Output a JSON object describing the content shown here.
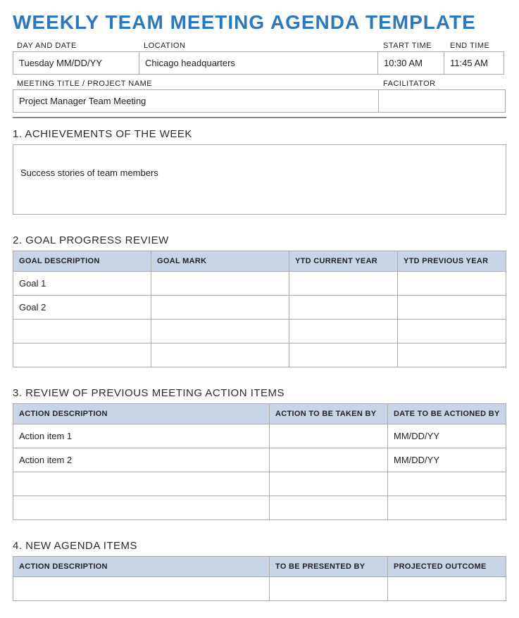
{
  "title": "WEEKLY TEAM MEETING AGENDA TEMPLATE",
  "info_top": {
    "labels": {
      "day_date": "DAY AND DATE",
      "location": "LOCATION",
      "start_time": "START TIME",
      "end_time": "END TIME"
    },
    "values": {
      "day_date": "Tuesday MM/DD/YY",
      "location": "Chicago headquarters",
      "start_time": "10:30 AM",
      "end_time": "11:45 AM"
    }
  },
  "info_meeting": {
    "labels": {
      "title_project": "MEETING TITLE / PROJECT NAME",
      "facilitator": "FACILITATOR"
    },
    "values": {
      "title_project": "Project Manager Team Meeting",
      "facilitator": ""
    }
  },
  "section1": {
    "heading": "1. ACHIEVEMENTS OF THE WEEK",
    "content": "Success stories of team members"
  },
  "section2": {
    "heading": "2. GOAL PROGRESS REVIEW",
    "headers": {
      "desc": "GOAL DESCRIPTION",
      "mark": "GOAL MARK",
      "ytd_curr": "YTD CURRENT YEAR",
      "ytd_prev": "YTD PREVIOUS YEAR"
    },
    "rows": [
      {
        "desc": "Goal 1",
        "mark": "",
        "ytd_curr": "",
        "ytd_prev": ""
      },
      {
        "desc": "Goal 2",
        "mark": "",
        "ytd_curr": "",
        "ytd_prev": ""
      },
      {
        "desc": "",
        "mark": "",
        "ytd_curr": "",
        "ytd_prev": ""
      },
      {
        "desc": "",
        "mark": "",
        "ytd_curr": "",
        "ytd_prev": ""
      }
    ]
  },
  "section3": {
    "heading": "3. REVIEW OF PREVIOUS MEETING ACTION ITEMS",
    "headers": {
      "desc": "ACTION DESCRIPTION",
      "by": "ACTION TO BE TAKEN BY",
      "date": "DATE TO BE ACTIONED BY"
    },
    "rows": [
      {
        "desc": "Action item 1",
        "by": "",
        "date": "MM/DD/YY"
      },
      {
        "desc": "Action item 2",
        "by": "",
        "date": "MM/DD/YY"
      },
      {
        "desc": "",
        "by": "",
        "date": ""
      },
      {
        "desc": "",
        "by": "",
        "date": ""
      }
    ]
  },
  "section4": {
    "heading": "4. NEW AGENDA ITEMS",
    "headers": {
      "desc": "ACTION DESCRIPTION",
      "by": "TO BE PRESENTED BY",
      "outcome": "PROJECTED OUTCOME"
    },
    "rows": [
      {
        "desc": "",
        "by": "",
        "outcome": ""
      }
    ]
  }
}
